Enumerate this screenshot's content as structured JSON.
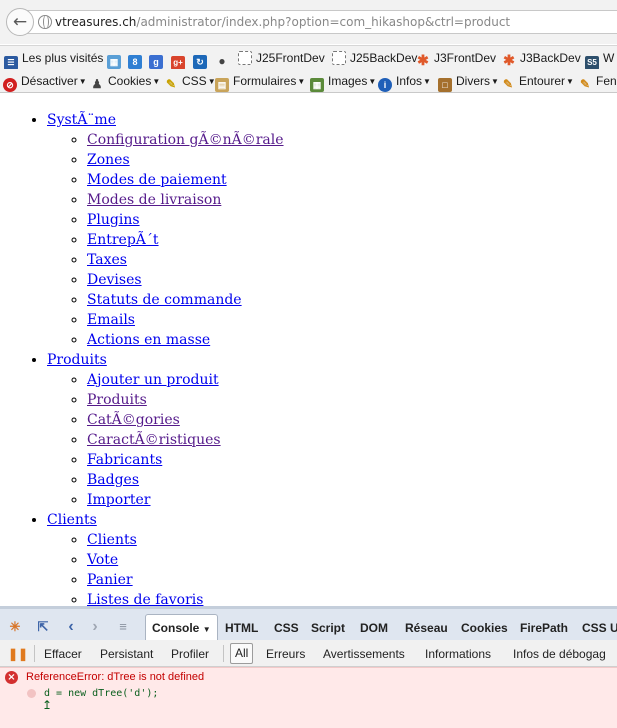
{
  "url": {
    "host": "vtreasures.ch",
    "path": "/administrator/index.php?option=com_hikashop&ctrl=product"
  },
  "bookmarks": [
    {
      "label": "Les plus visités",
      "icon": "bookmarks-icon"
    },
    {
      "label": "",
      "icon": "grid-icon"
    },
    {
      "label": "",
      "icon": "number-8-icon"
    },
    {
      "label": "",
      "icon": "google-icon"
    },
    {
      "label": "",
      "icon": "google-plus-icon"
    },
    {
      "label": "",
      "icon": "refresh-icon"
    },
    {
      "label": "",
      "icon": "apple-icon"
    },
    {
      "label": "J25FrontDev",
      "icon": "dotted-box-icon"
    },
    {
      "label": "J25BackDev",
      "icon": "dotted-box-icon"
    },
    {
      "label": "J3FrontDev",
      "icon": "joomla-icon"
    },
    {
      "label": "J3BackDev",
      "icon": "joomla-icon"
    },
    {
      "label": "W",
      "icon": "s5-icon"
    }
  ],
  "toolbar": [
    {
      "label": "Désactiver",
      "icon": "disable-icon"
    },
    {
      "label": "Cookies",
      "icon": "user-icon"
    },
    {
      "label": "CSS",
      "icon": "pencil-icon"
    },
    {
      "label": "Formulaires",
      "icon": "form-icon"
    },
    {
      "label": "Images",
      "icon": "image-icon"
    },
    {
      "label": "Infos",
      "icon": "info-icon"
    },
    {
      "label": "Divers",
      "icon": "book-icon"
    },
    {
      "label": "Entourer",
      "icon": "ruler-icon"
    },
    {
      "label": "Fen",
      "icon": "pencil-icon"
    }
  ],
  "menu": [
    {
      "label": "SystÃ¨me",
      "items": [
        "Configuration gÃ©nÃ©rale",
        "Zones",
        "Modes de paiement",
        "Modes de livraison",
        "Plugins",
        "EntrepÃ´t",
        "Taxes",
        "Devises",
        "Statuts de commande",
        "Emails",
        "Actions en masse"
      ]
    },
    {
      "label": "Produits",
      "items": [
        "Ajouter un produit",
        "Produits",
        "CatÃ©gories",
        "CaractÃ©ristiques",
        "Fabricants",
        "Badges",
        "Importer"
      ]
    },
    {
      "label": "Clients",
      "items": [
        "Clients",
        "Vote",
        "Panier",
        "Listes de favoris"
      ]
    }
  ],
  "firebug": {
    "tabs": [
      "Console",
      "HTML",
      "CSS",
      "Script",
      "DOM",
      "Réseau",
      "Cookies",
      "FirePath",
      "CSS Us"
    ],
    "console_toolbar": [
      "Effacer",
      "Persistant",
      "Profiler",
      "All",
      "Erreurs",
      "Avertissements",
      "Informations",
      "Infos de débogag"
    ],
    "error": {
      "message": "ReferenceError: dTree is not defined",
      "code": "d = new dTree('d');"
    }
  }
}
